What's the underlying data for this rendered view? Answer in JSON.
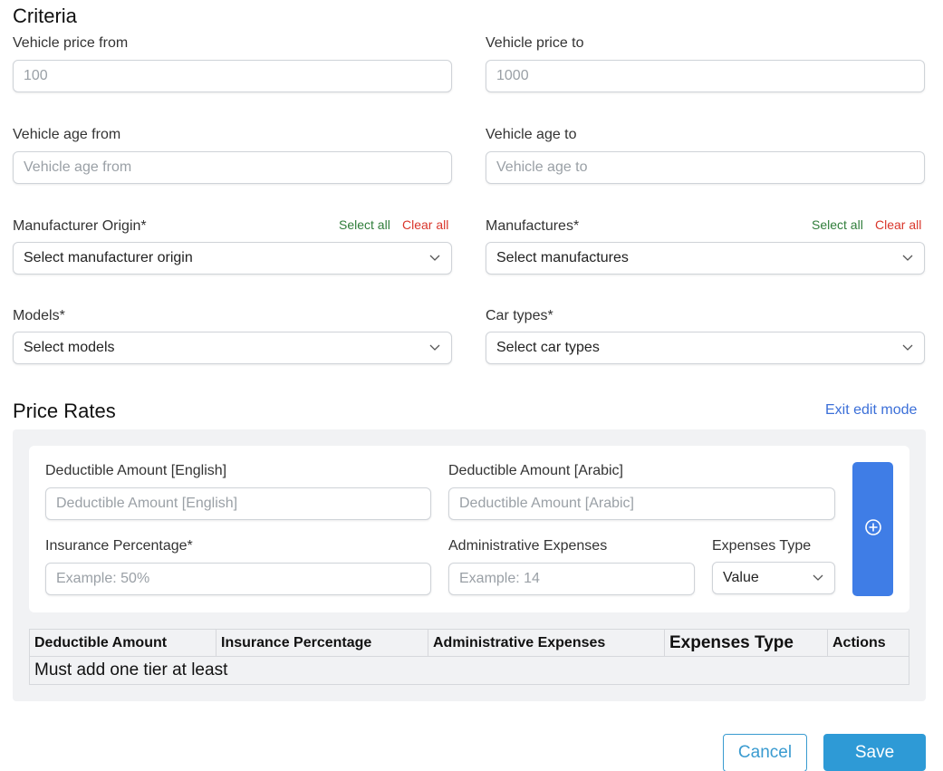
{
  "criteria": {
    "title": "Criteria",
    "price_from": {
      "label": "Vehicle price from",
      "placeholder": "100"
    },
    "price_to": {
      "label": "Vehicle price to",
      "placeholder": "1000"
    },
    "age_from": {
      "label": "Vehicle age from",
      "placeholder": "Vehicle age from"
    },
    "age_to": {
      "label": "Vehicle age to",
      "placeholder": "Vehicle age to"
    },
    "manufacturer_origin": {
      "label": "Manufacturer Origin*",
      "value": "Select manufacturer origin",
      "select_all": "Select all",
      "clear_all": "Clear all"
    },
    "manufactures": {
      "label": "Manufactures*",
      "value": "Select manufactures",
      "select_all": "Select all",
      "clear_all": "Clear all"
    },
    "models": {
      "label": "Models*",
      "value": "Select models"
    },
    "car_types": {
      "label": "Car types*",
      "value": "Select car types"
    }
  },
  "price_rates": {
    "title": "Price Rates",
    "exit_edit": "Exit edit mode",
    "deductible_en": {
      "label": "Deductible Amount [English]",
      "placeholder": "Deductible Amount [English]"
    },
    "deductible_ar": {
      "label": "Deductible Amount [Arabic]",
      "placeholder": "Deductible Amount [Arabic]"
    },
    "insurance_pct": {
      "label": "Insurance Percentage*",
      "placeholder": "Example: 50%"
    },
    "admin_expenses": {
      "label": "Administrative Expenses",
      "placeholder": "Example: 14"
    },
    "expenses_type": {
      "label": "Expenses Type",
      "value": "Value"
    },
    "table": {
      "headers": [
        "Deductible Amount",
        "Insurance Percentage",
        "Administrative Expenses",
        "Expenses Type",
        "Actions"
      ],
      "empty_message": "Must add one tier at least"
    }
  },
  "actions": {
    "cancel": "Cancel",
    "save": "Save"
  },
  "colors": {
    "primary": "#3f7de6",
    "save": "#2e9ad6",
    "select_all": "#2f7d3a",
    "clear_all": "#d9362b",
    "link": "#3b6fd8"
  },
  "icons": {
    "dropdown": "chevron-down-icon",
    "add": "plus-circle-icon"
  }
}
